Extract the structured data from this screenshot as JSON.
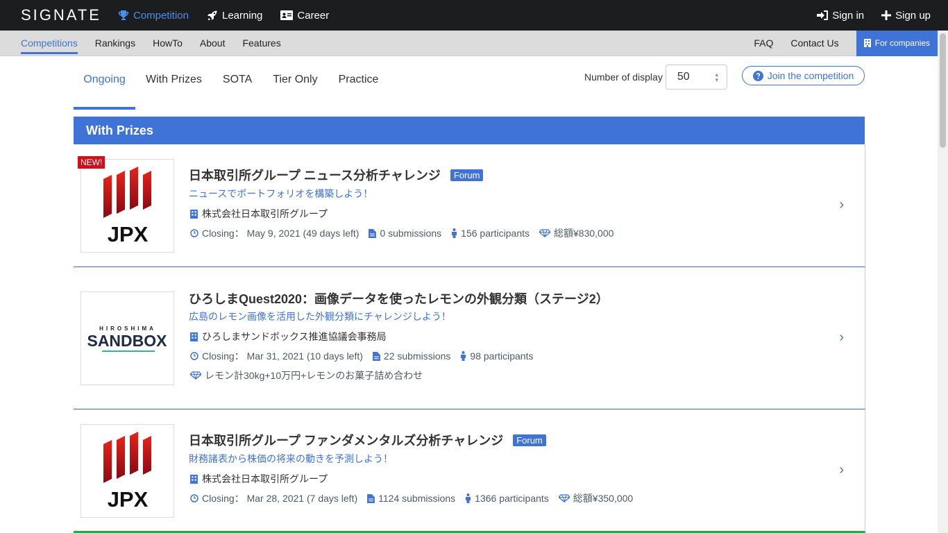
{
  "header": {
    "logo": "SIGNATE",
    "nav": [
      {
        "label": "Competition",
        "icon": "trophy-icon",
        "active": true
      },
      {
        "label": "Learning",
        "icon": "rocket-icon"
      },
      {
        "label": "Career",
        "icon": "id-card-icon"
      }
    ],
    "sign_in": "Sign in",
    "sign_up": "Sign up"
  },
  "subnav": {
    "items": [
      "Competitions",
      "Rankings",
      "HowTo",
      "About",
      "Features"
    ],
    "faq": "FAQ",
    "contact": "Contact Us",
    "for_companies": "For companies"
  },
  "tabs": [
    "Ongoing",
    "With Prizes",
    "SOTA",
    "Tier Only",
    "Practice"
  ],
  "display": {
    "label": "Number of display",
    "value": "50"
  },
  "join_button": "Join the competition",
  "section_title": "With Prizes",
  "cards": [
    {
      "badge": "NEW!",
      "logo_text": "JPX",
      "title": "日本取引所グループ ニュース分析チャレンジ",
      "forum": "Forum",
      "subtitle": "ニュースでポートフォリオを構築しよう！",
      "org": "株式会社日本取引所グループ",
      "closing_label": "Closing：",
      "closing": "May 9, 2021 (49 days left)",
      "submissions": "0 submissions",
      "participants": "156 participants",
      "prize": "総額¥830,000"
    },
    {
      "logo_text": "SANDBOX",
      "logo_top": "HIROSHIMA",
      "title": "ひろしまQuest2020：画像データを使ったレモンの外観分類（ステージ2）",
      "subtitle": "広島のレモン画像を活用した外観分類にチャレンジしよう！",
      "org": "ひろしまサンドボックス推進協議会事務局",
      "closing_label": "Closing：",
      "closing": "Mar 31, 2021 (10 days left)",
      "submissions": "22 submissions",
      "participants": "98 participants",
      "prize": "レモン計30kg+10万円+レモンのお菓子詰め合わせ"
    },
    {
      "logo_text": "JPX",
      "title": "日本取引所グループ ファンダメンタルズ分析チャレンジ",
      "forum": "Forum",
      "subtitle": "財務諸表から株価の将来の動きを予測しよう！",
      "org": "株式会社日本取引所グループ",
      "closing_label": "Closing：",
      "closing": "Mar 28, 2021 (7 days left)",
      "submissions": "1124 submissions",
      "participants": "1366 participants",
      "prize": "総額¥350,000"
    }
  ],
  "colors": {
    "accent": "#3f73d5",
    "topbar": "#1b1d1f",
    "subbar": "#dcdcdc",
    "jpx_red": "#d0101b"
  }
}
